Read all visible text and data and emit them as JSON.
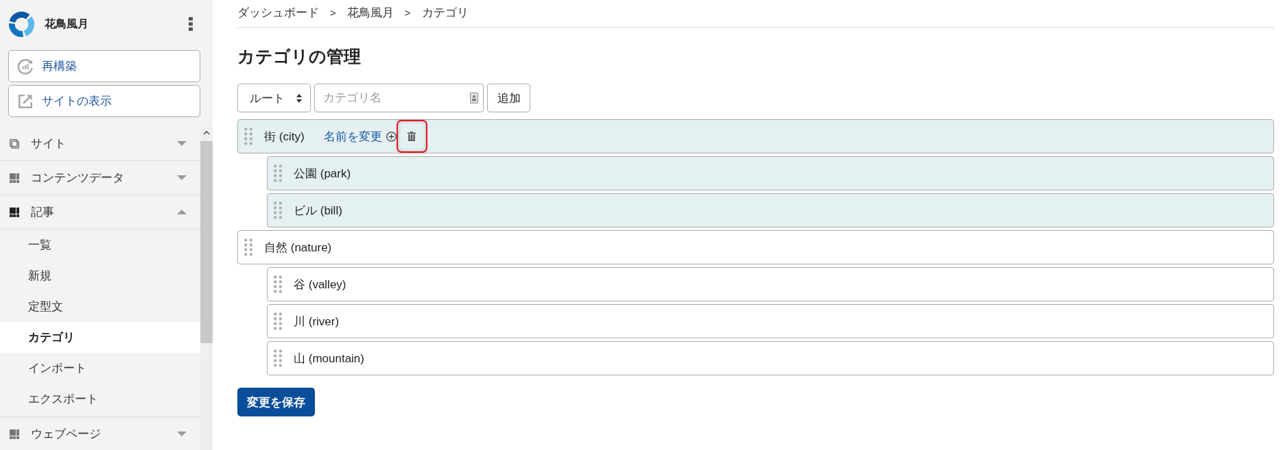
{
  "sidebar": {
    "site_name": "花鳥風月",
    "actions": [
      {
        "kind": "rebuild",
        "label": "再構築"
      },
      {
        "kind": "view",
        "label": "サイトの表示"
      }
    ],
    "nav": [
      {
        "kind": "window",
        "label": "サイト",
        "expanded": false
      },
      {
        "kind": "module",
        "label": "コンテンツデータ",
        "expanded": false
      },
      {
        "kind": "module",
        "label": "記事",
        "expanded": true,
        "children": [
          {
            "label": "一覧",
            "selected": false
          },
          {
            "label": "新規",
            "selected": false
          },
          {
            "label": "定型文",
            "selected": false
          },
          {
            "label": "カテゴリ",
            "selected": true
          },
          {
            "label": "インポート",
            "selected": false
          },
          {
            "label": "エクスポート",
            "selected": false
          }
        ]
      },
      {
        "kind": "module",
        "label": "ウェブページ",
        "expanded": false
      }
    ]
  },
  "breadcrumb": {
    "separator": ">",
    "items": [
      "ダッシュボード",
      "花鳥風月",
      "カテゴリ"
    ]
  },
  "title": "カテゴリの管理",
  "add_form": {
    "parent_select": {
      "value": "ルート"
    },
    "name_field": {
      "placeholder": "カテゴリ名"
    },
    "add_button": "追加"
  },
  "categories": [
    {
      "label": "街 (city)",
      "highlighted": true,
      "hover_actions": {
        "rename_link": "名前を変更",
        "delete_focused": true
      },
      "children": [
        {
          "label": "公園 (park)",
          "highlighted": true
        },
        {
          "label": "ビル (bill)",
          "highlighted": true
        }
      ]
    },
    {
      "label": "自然 (nature)",
      "highlighted": false,
      "children": [
        {
          "label": "谷 (valley)",
          "highlighted": false
        },
        {
          "label": "川 (river)",
          "highlighted": false
        },
        {
          "label": "山 (mountain)",
          "highlighted": false
        }
      ]
    }
  ],
  "save_button": "変更を保存"
}
